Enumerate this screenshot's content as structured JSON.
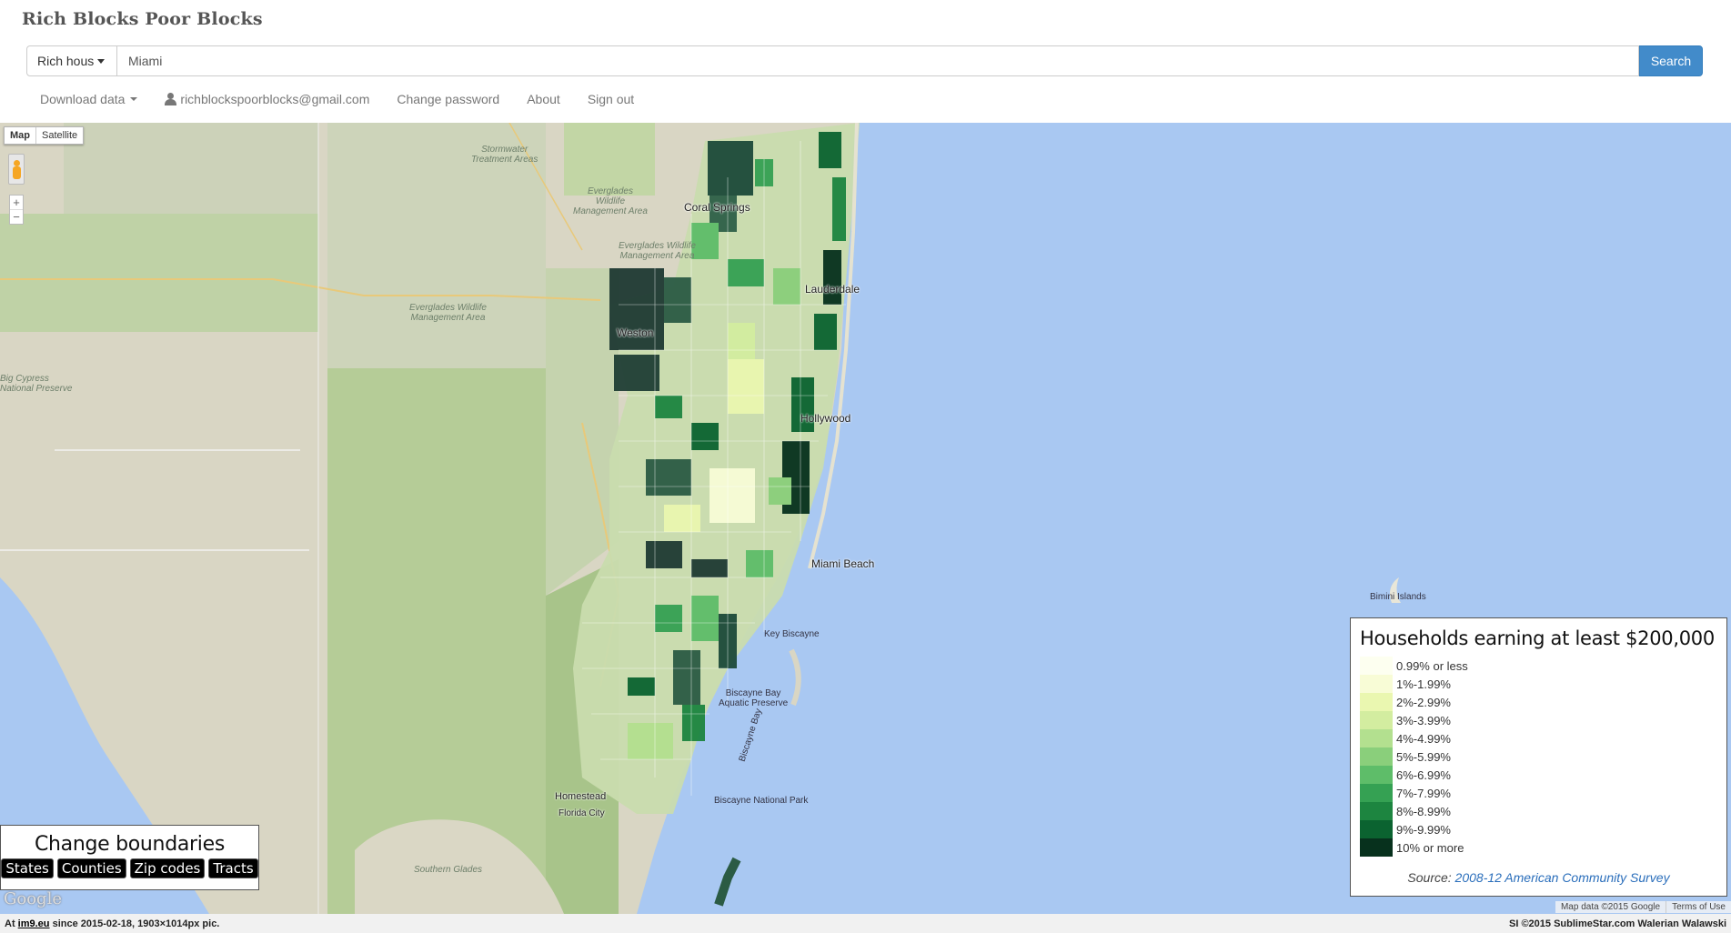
{
  "brand": "Rich Blocks Poor Blocks",
  "search": {
    "type_label": "Rich hous",
    "value": "Miami",
    "button_label": "Search"
  },
  "nav": {
    "download_label": "Download data",
    "user_email": "richblockspoorblocks@gmail.com",
    "change_password_label": "Change password",
    "about_label": "About",
    "sign_out_label": "Sign out"
  },
  "map": {
    "type_map": "Map",
    "type_satellite": "Satellite",
    "zoom_in": "+",
    "zoom_out": "−",
    "labels": {
      "stormwater": "Stormwater\nTreatment Areas",
      "everglades1": "Everglades\nWildlife\nManagement Area",
      "everglades2": "Everglades Wildlife\nManagement Area",
      "everglades3": "Everglades Wildlife\nManagement Area",
      "big_cypress": "Big Cypress\nNational Preserve",
      "biscayne_bay": "Biscayne Bay\nAquatic Preserve",
      "biscayne_np": "Biscayne National Park",
      "bimini": "Bimini Islands",
      "key_biscayne": "Key Biscayne",
      "miami_beach": "Miami Beach",
      "hollywood": "Hollywood",
      "fort_lauderdale": "Lauderdale",
      "coral_springs": "Coral Springs",
      "weston": "Weston",
      "homestead": "Homestead",
      "florida_city": "Florida City",
      "biscayne_bay_water": "Biscayne Bay",
      "southern_glades": "Southern Glades"
    },
    "google": "Google",
    "map_data": "Map data ©2015 Google",
    "terms": "Terms of Use"
  },
  "legend": {
    "title": "Households earning at least $200,000",
    "items": [
      {
        "label": "0.99% or less",
        "color": "#fdfff0"
      },
      {
        "label": "1%-1.99%",
        "color": "#f8fcd6"
      },
      {
        "label": "2%-2.99%",
        "color": "#eaf7b0"
      },
      {
        "label": "3%-3.99%",
        "color": "#d3eda0"
      },
      {
        "label": "4%-4.99%",
        "color": "#b3e08f"
      },
      {
        "label": "5%-5.99%",
        "color": "#8acf7b"
      },
      {
        "label": "6%-6.99%",
        "color": "#5ebd69"
      },
      {
        "label": "7%-7.99%",
        "color": "#35a153"
      },
      {
        "label": "8%-8.99%",
        "color": "#1d8540"
      },
      {
        "label": "9%-9.99%",
        "color": "#0b6330"
      },
      {
        "label": "10% or more",
        "color": "#07311d"
      }
    ],
    "source_prefix": "Source:",
    "source_link": "2008-12 American Community Survey"
  },
  "boundaries": {
    "title": "Change boundaries",
    "buttons": [
      "States",
      "Counties",
      "Zip codes",
      "Tracts"
    ]
  },
  "footer": {
    "left_prefix": "At",
    "left_link": "im9.eu",
    "left_suffix": "since 2015-02-18, 1903×1014px pic.",
    "right": "SI ©2015 SublimeStar.com Walerian Walawski"
  }
}
